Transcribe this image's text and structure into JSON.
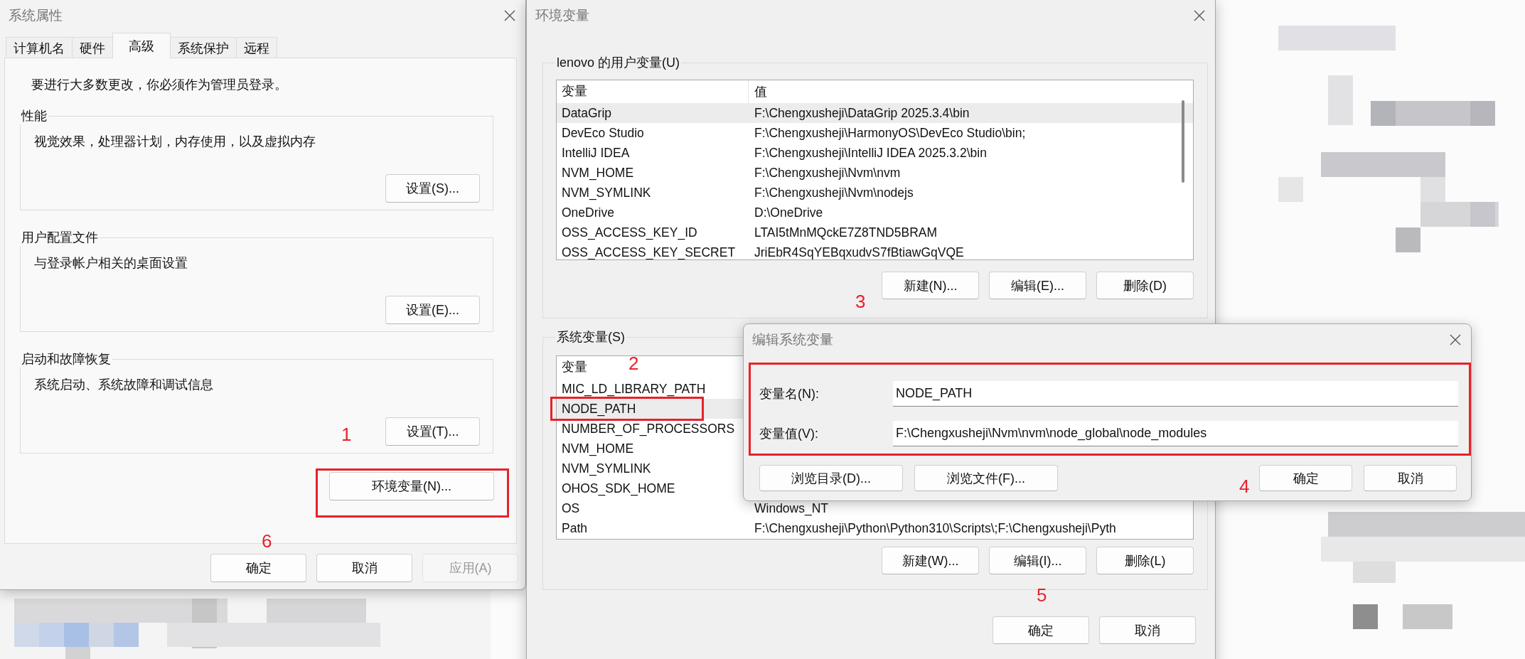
{
  "system_properties": {
    "title": "系统属性",
    "tabs": [
      {
        "label": "计算机名",
        "selected": false
      },
      {
        "label": "硬件",
        "selected": false
      },
      {
        "label": "高级",
        "selected": true
      },
      {
        "label": "系统保护",
        "selected": false
      },
      {
        "label": "远程",
        "selected": false
      }
    ],
    "notice": "要进行大多数更改，你必须作为管理员登录。",
    "groups": [
      {
        "legend": "性能",
        "description": "视觉效果，处理器计划，内存使用，以及虚拟内存",
        "button": "设置(S)..."
      },
      {
        "legend": "用户配置文件",
        "description": "与登录帐户相关的桌面设置",
        "button": "设置(E)..."
      },
      {
        "legend": "启动和故障恢复",
        "description": "系统启动、系统故障和调试信息",
        "button": "设置(T)..."
      }
    ],
    "env_button": "环境变量(N)...",
    "buttons": [
      {
        "label": "确定",
        "disabled": false
      },
      {
        "label": "取消",
        "disabled": false
      },
      {
        "label": "应用(A)",
        "disabled": true
      }
    ]
  },
  "environment_variables": {
    "title": "环境变量",
    "user_group": {
      "legend": "lenovo 的用户变量(U)",
      "columns": [
        "变量",
        "值"
      ],
      "rows": [
        {
          "name": "DataGrip",
          "value": "F:\\Chengxusheji\\DataGrip 2025.3.4\\bin",
          "selected": true
        },
        {
          "name": "DevEco Studio",
          "value": "F:\\Chengxusheji\\HarmonyOS\\DevEco Studio\\bin;",
          "selected": false
        },
        {
          "name": "IntelliJ IDEA",
          "value": "F:\\Chengxusheji\\IntelliJ IDEA 2025.3.2\\bin",
          "selected": false
        },
        {
          "name": "NVM_HOME",
          "value": "F:\\Chengxusheji\\Nvm\\nvm",
          "selected": false
        },
        {
          "name": "NVM_SYMLINK",
          "value": "F:\\Chengxusheji\\Nvm\\nodejs",
          "selected": false
        },
        {
          "name": "OneDrive",
          "value": "D:\\OneDrive",
          "selected": false
        },
        {
          "name": "OSS_ACCESS_KEY_ID",
          "value": "LTAI5tMnMQckE7Z8TND5BRAM",
          "selected": false
        },
        {
          "name": "OSS_ACCESS_KEY_SECRET",
          "value": "JriEbR4SqYEBqxudvS7fBtiawGqVQE",
          "selected": false
        }
      ],
      "buttons": [
        "新建(N)...",
        "编辑(E)...",
        "删除(D)"
      ]
    },
    "system_group": {
      "legend": "系统变量(S)",
      "columns": [
        "变量"
      ],
      "rows": [
        {
          "name": "MIC_LD_LIBRARY_PATH",
          "selected": false
        },
        {
          "name": "NODE_PATH",
          "selected": true
        },
        {
          "name": "NUMBER_OF_PROCESSORS",
          "selected": false
        },
        {
          "name": "NVM_HOME",
          "selected": false
        },
        {
          "name": "NVM_SYMLINK",
          "selected": false
        },
        {
          "name": "OHOS_SDK_HOME",
          "selected": false
        },
        {
          "name": "OS",
          "value": "Windows_NT",
          "selected": false
        },
        {
          "name": "Path",
          "value": "F:\\Chengxusheji\\Python\\Python310\\Scripts\\;F:\\Chengxusheji\\Pyth",
          "selected": false
        }
      ],
      "buttons": [
        "新建(W)...",
        "编辑(I)...",
        "删除(L)"
      ]
    },
    "buttons": [
      "确定",
      "取消"
    ]
  },
  "edit_dialog": {
    "title": "编辑系统变量",
    "fields": [
      {
        "label": "变量名(N):",
        "value": "NODE_PATH"
      },
      {
        "label": "变量值(V):",
        "value": "F:\\Chengxusheji\\Nvm\\nvm\\node_global\\node_modules"
      }
    ],
    "browse_buttons": [
      "浏览目录(D)...",
      "浏览文件(F)..."
    ],
    "buttons": [
      "确定",
      "取消"
    ]
  },
  "annotations": [
    "1",
    "2",
    "3",
    "4",
    "5",
    "6"
  ]
}
